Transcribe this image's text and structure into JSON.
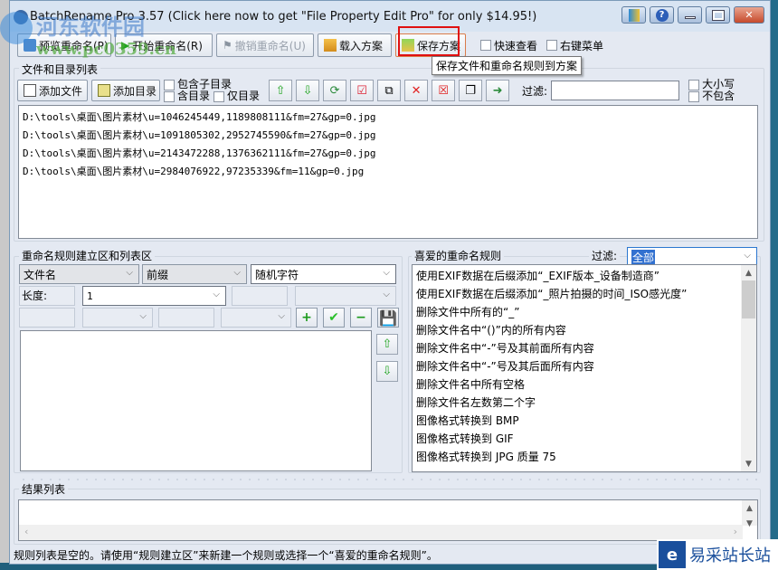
{
  "window": {
    "title": "BatchRename Pro 3.57  (Click here now to get \"File Property Edit Pro\" for only $14.95!)",
    "controls": [
      "app-icon",
      "help",
      "minimize",
      "maximize",
      "close"
    ]
  },
  "toolbar": {
    "preview_label": "预览重命名(P)",
    "start_label": "开始重命名(R)",
    "undo_label": "撤销重命名(U)",
    "load_label": "载入方案",
    "save_label": "保存方案",
    "quick_view_label": "快速查看",
    "context_menu_label": "右键菜单",
    "save_tooltip": "保存文件和重命名规则到方案"
  },
  "files_section": {
    "title": "文件和目录列表",
    "add_file_label": "添加文件",
    "add_dir_label": "添加目录",
    "include_subdirs_label": "包含子目录",
    "include_dirs_label": "含目录",
    "dirs_only_label": "仅目录",
    "icon_buttons": [
      "move-up",
      "move-down",
      "refresh",
      "check",
      "swap",
      "delete",
      "delete-all",
      "copy",
      "import"
    ],
    "filter_label": "过滤:",
    "filter_value": "",
    "case_label": "大小写",
    "exclude_label": "不包含",
    "files": [
      "D:\\tools\\桌面\\图片素材\\u=1046245449,1189808111&fm=27&gp=0.jpg",
      "D:\\tools\\桌面\\图片素材\\u=1091805302,2952745590&fm=27&gp=0.jpg",
      "D:\\tools\\桌面\\图片素材\\u=2143472288,1376362111&fm=27&gp=0.jpg",
      "D:\\tools\\桌面\\图片素材\\u=2984076922,97235339&fm=11&gp=0.jpg"
    ]
  },
  "rules_section": {
    "title": "重命名规则建立区和列表区",
    "target_select": "文件名",
    "position_select": "前缀",
    "type_select": "随机字符",
    "length_label": "长度:",
    "length_value": "1",
    "add_button": "+",
    "apply_button": "✔",
    "remove_button": "−",
    "save_button": "save"
  },
  "favorites_section": {
    "title": "喜爱的重命名规则",
    "filter_label": "过滤:",
    "filter_value": "全部",
    "items": [
      "使用EXIF数据在后缀添加“_EXIF版本_设备制造商”",
      "使用EXIF数据在后缀添加“_照片拍摄的时间_ISO感光度”",
      "删除文件中所有的“_”",
      "删除文件名中“()”内的所有内容",
      "删除文件名中“-”号及其前面所有内容",
      "删除文件名中“-”号及其后面所有内容",
      "删除文件名中所有空格",
      "删除文件名左数第二个字",
      "图像格式转换到 BMP",
      "图像格式转换到 GIF",
      "图像格式转换到 JPG 质量 75"
    ]
  },
  "results_section": {
    "title": "结果列表"
  },
  "status": {
    "text": "规则列表是空的。请使用“规则建立区”来新建一个规则或选择一个“喜爱的重命名规则”。"
  },
  "watermarks": {
    "top": "河东软件园",
    "top_url": "www.pc0359.cn",
    "bottom": "易采站长站"
  }
}
